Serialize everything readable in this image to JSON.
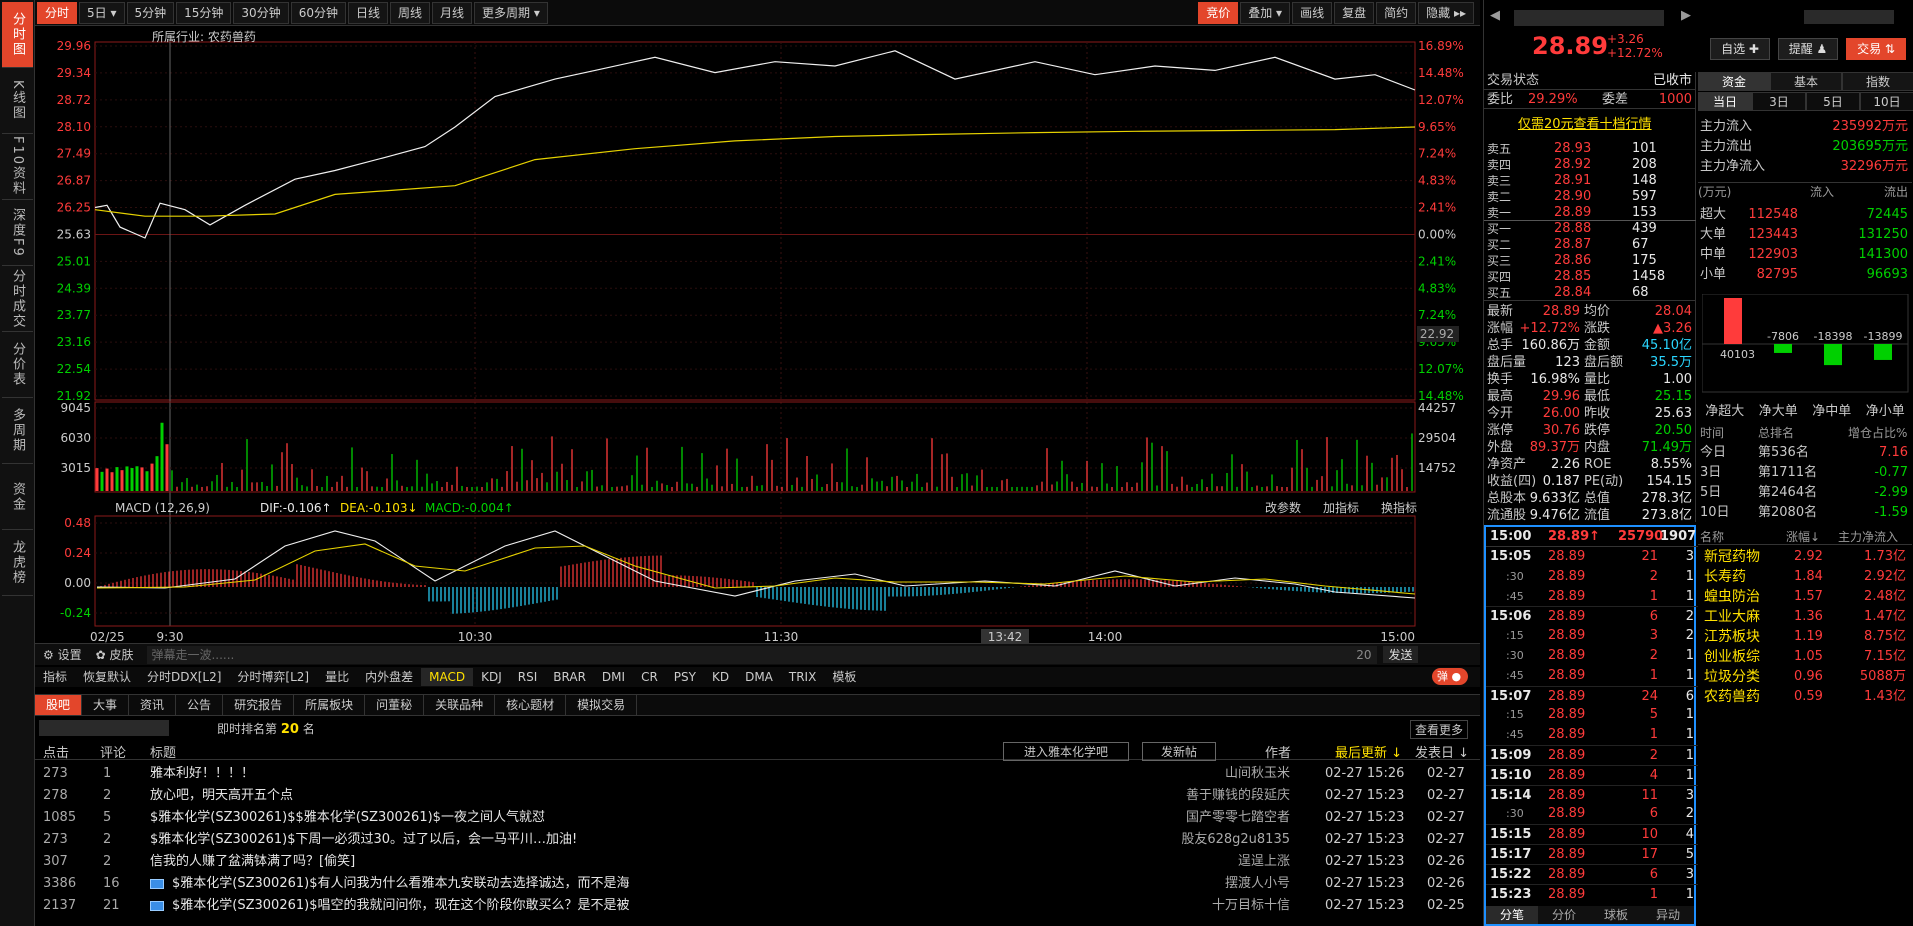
{
  "left_rail": [
    {
      "label": "分时图",
      "active": true
    },
    {
      "label": "K线图"
    },
    {
      "label": "F10资料"
    },
    {
      "label": "深度F9"
    },
    {
      "label": "分时成交"
    },
    {
      "label": "分价表"
    },
    {
      "label": "多周期"
    },
    {
      "label": "资金"
    },
    {
      "label": "龙虎榜"
    }
  ],
  "period_tabs": [
    "分时",
    "5日 ▾",
    "5分钟",
    "15分钟",
    "30分钟",
    "60分钟",
    "日线",
    "周线",
    "月线",
    "更多周期 ▾"
  ],
  "tool_tabs": [
    "竞价",
    "叠加 ▾",
    "画线",
    "复盘",
    "简约",
    "隐藏 ▸▸"
  ],
  "chart_info": {
    "industry_label": "所属行业:",
    "industry": "农药兽药"
  },
  "price_axis_left": [
    "29.96",
    "29.34",
    "28.72",
    "28.10",
    "27.49",
    "26.87",
    "26.25",
    "25.63",
    "25.01",
    "24.39",
    "23.77",
    "23.16",
    "22.54",
    "21.92"
  ],
  "pct_axis_right": [
    "16.89%",
    "14.48%",
    "12.07%",
    "9.65%",
    "7.24%",
    "4.83%",
    "2.41%",
    "0.00%",
    "2.41%",
    "4.83%",
    "7.24%",
    "9.65%",
    "12.07%",
    "14.48%"
  ],
  "cursor_price": "22.92",
  "volume_axis_left": [
    "9045",
    "6030",
    "3015"
  ],
  "volume_axis_right": [
    "44257",
    "29504",
    "14752"
  ],
  "macd_header": {
    "name": "MACD (12,26,9)",
    "dif": "DIF:-0.106↑",
    "dea": "DEA:-0.103↓",
    "macd": "MACD:-0.004↑",
    "right_tools": [
      "改参数",
      "加指标",
      "换指标"
    ]
  },
  "macd_axis": [
    "0.48",
    "0.24",
    "0.00",
    "-0.24"
  ],
  "time_axis": [
    "02/25",
    "9:30",
    "10:30",
    "11:30",
    "13:42",
    "14:00",
    "15:00"
  ],
  "bottom_controls": {
    "settings": "设置",
    "skin": "皮肤",
    "danmu_placeholder": "弹幕走一波......",
    "danmu_count": "20",
    "send": "发送",
    "danmu_toggle": "弹"
  },
  "indicator_tabs": [
    "指标",
    "恢复默认",
    "分时DDX[L2]",
    "分时博弈[L2]",
    "量比",
    "内外盘差",
    "MACD",
    "KDJ",
    "RSI",
    "BRAR",
    "DMI",
    "CR",
    "PSY",
    "KD",
    "DMA",
    "TRIX",
    "模板"
  ],
  "bottom_tabs": [
    "股吧",
    "大事",
    "资讯",
    "公告",
    "研究报告",
    "所属板块",
    "问董秘",
    "关联品种",
    "核心题材",
    "模拟交易"
  ],
  "forum": {
    "rank_label": "即时排名第",
    "rank": "20",
    "rank_unit": "名",
    "more": "查看更多",
    "enter_btn": "进入雅本化学吧",
    "post_btn": "发新帖",
    "cols": [
      "点击",
      "评论",
      "标题",
      "作者",
      "最后更新 ↓",
      "发表日 ↓"
    ],
    "posts": [
      {
        "clicks": "273",
        "comments": "1",
        "title": "雅本利好！！！！",
        "author": "山间秋玉米",
        "updated": "02-27 15:26",
        "date": "02-27",
        "icon": false
      },
      {
        "clicks": "278",
        "comments": "2",
        "title": "放心吧，明天高开五个点",
        "author": "善于赚钱的段延庆",
        "updated": "02-27 15:23",
        "date": "02-27",
        "icon": false
      },
      {
        "clicks": "1085",
        "comments": "5",
        "title": "$雅本化学(SZ300261)$$雅本化学(SZ300261)$一夜之间人气就怼",
        "author": "国产零零七踏空者",
        "updated": "02-27 15:23",
        "date": "02-27",
        "icon": false
      },
      {
        "clicks": "273",
        "comments": "2",
        "title": "$雅本化学(SZ300261)$下周一必须过30。过了以后，会一马平川…加油!",
        "author": "股友628g2u8135",
        "updated": "02-27 15:23",
        "date": "02-27",
        "icon": false
      },
      {
        "clicks": "307",
        "comments": "2",
        "title": "信我的人赚了盆满钵满了吗？[偷笑]",
        "author": "逞逞上涨",
        "updated": "02-27 15:23",
        "date": "02-26",
        "icon": false
      },
      {
        "clicks": "3386",
        "comments": "16",
        "title": "$雅本化学(SZ300261)$有人问我为什么看雅本九安联动去选择诚达，而不是海",
        "author": "摆渡人小号",
        "updated": "02-27 15:23",
        "date": "02-26",
        "icon": true
      },
      {
        "clicks": "2137",
        "comments": "21",
        "title": "$雅本化学(SZ300261)$唱空的我就问问你，现在这个阶段你敢买么？是不是被",
        "author": "十万目标十信",
        "updated": "02-27 15:23",
        "date": "02-25",
        "icon": true
      }
    ]
  },
  "quote": {
    "price": "28.89",
    "change": "+3.26",
    "change_pct": "+12.72%",
    "btn_watch": "自选 ✚",
    "btn_alert": "提醒 ♟",
    "btn_trade": "交易 ⇅"
  },
  "status": {
    "label": "交易状态",
    "value": "已收市",
    "weibi_label": "委比",
    "weibi": "29.29%",
    "weicha_label": "委差",
    "weicha": "1000"
  },
  "ten_level": "仅需20元查看十档行情",
  "asks": [
    {
      "label": "卖五",
      "price": "28.93",
      "vol": "101"
    },
    {
      "label": "卖四",
      "price": "28.92",
      "vol": "208"
    },
    {
      "label": "卖三",
      "price": "28.91",
      "vol": "148"
    },
    {
      "label": "卖二",
      "price": "28.90",
      "vol": "597"
    },
    {
      "label": "卖一",
      "price": "28.89",
      "vol": "153"
    }
  ],
  "bids": [
    {
      "label": "买一",
      "price": "28.88",
      "vol": "439"
    },
    {
      "label": "买二",
      "price": "28.87",
      "vol": "67"
    },
    {
      "label": "买三",
      "price": "28.86",
      "vol": "175"
    },
    {
      "label": "买四",
      "price": "28.85",
      "vol": "1458"
    },
    {
      "label": "买五",
      "price": "28.84",
      "vol": "68"
    }
  ],
  "stats": [
    [
      "最新",
      "28.89",
      "red",
      "均价",
      "28.04",
      "red"
    ],
    [
      "涨幅",
      "+12.72%",
      "red",
      "涨跌",
      "▲3.26",
      "red"
    ],
    [
      "总手",
      "160.86万",
      "white",
      "金额",
      "45.10亿",
      "cyan"
    ],
    [
      "盘后量",
      "123",
      "white",
      "盘后额",
      "35.5万",
      "cyan"
    ],
    [
      "换手",
      "16.98%",
      "white",
      "量比",
      "1.00",
      "white"
    ],
    [
      "最高",
      "29.96",
      "red",
      "最低",
      "25.15",
      "green"
    ],
    [
      "今开",
      "26.00",
      "red",
      "昨收",
      "25.63",
      "white"
    ],
    [
      "涨停",
      "30.76",
      "red",
      "跌停",
      "20.50",
      "green"
    ],
    [
      "外盘",
      "89.37万",
      "red",
      "内盘",
      "71.49万",
      "green"
    ],
    [
      "净资产",
      "2.26",
      "white",
      "ROE",
      "8.55%",
      "white"
    ],
    [
      "收益(四)",
      "0.187",
      "white",
      "PE(动)",
      "154.15",
      "white"
    ],
    [
      "总股本",
      "9.633亿",
      "white",
      "总值",
      "278.3亿",
      "white"
    ],
    [
      "流通股",
      "9.476亿",
      "white",
      "流值",
      "273.8亿",
      "white"
    ]
  ],
  "trades": {
    "last": {
      "time": "15:00",
      "price": "28.89↑",
      "vol": "25790",
      "num": "1907"
    },
    "rows": [
      [
        "15:05",
        "28.89",
        "21",
        "3"
      ],
      [
        ":30",
        "28.89",
        "2",
        "1"
      ],
      [
        ":45",
        "28.89",
        "1",
        "1"
      ],
      [
        "15:06",
        "28.89",
        "6",
        "2"
      ],
      [
        ":15",
        "28.89",
        "3",
        "2"
      ],
      [
        ":30",
        "28.89",
        "2",
        "1"
      ],
      [
        ":45",
        "28.89",
        "1",
        "1"
      ],
      [
        "15:07",
        "28.89",
        "24",
        "6"
      ],
      [
        ":15",
        "28.89",
        "5",
        "1"
      ],
      [
        ":45",
        "28.89",
        "1",
        "1"
      ],
      [
        "15:09",
        "28.89",
        "2",
        "1"
      ],
      [
        "15:10",
        "28.89",
        "4",
        "1"
      ],
      [
        "15:14",
        "28.89",
        "11",
        "3"
      ],
      [
        ":30",
        "28.89",
        "6",
        "2"
      ],
      [
        "15:15",
        "28.89",
        "10",
        "4"
      ],
      [
        "15:17",
        "28.89",
        "17",
        "5"
      ],
      [
        "15:22",
        "28.89",
        "6",
        "3"
      ],
      [
        "15:23",
        "28.89",
        "1",
        "1"
      ]
    ],
    "tabs": [
      "分笔",
      "分价",
      "球板",
      "异动"
    ]
  },
  "fund": {
    "tabs": [
      "资金",
      "基本",
      "指数"
    ],
    "subtabs": [
      "当日",
      "3日",
      "5日",
      "10日"
    ],
    "main_in_label": "主力流入",
    "main_in": "235992万元",
    "main_out_label": "主力流出",
    "main_out": "203695万元",
    "main_net_label": "主力净流入",
    "main_net": "32296万元",
    "unit": "(万元)",
    "flow_in": "流入",
    "flow_out": "流出",
    "orders": [
      [
        "超大",
        "112548",
        "72445"
      ],
      [
        "大单",
        "123443",
        "131250"
      ],
      [
        "中单",
        "122903",
        "141300"
      ],
      [
        "小单",
        "82795",
        "96693"
      ]
    ],
    "net_bars": [
      {
        "label": "净超大",
        "value": 40103
      },
      {
        "label": "净大单",
        "value": -7806
      },
      {
        "label": "净中单",
        "value": -18398
      },
      {
        "label": "净小单",
        "value": -13899
      }
    ],
    "rank_cols": [
      "时间",
      "总排名",
      "增仓占比%"
    ],
    "ranks": [
      [
        "今日",
        "第536名",
        "7.16",
        "red"
      ],
      [
        "3日",
        "第1711名",
        "-0.77",
        "green"
      ],
      [
        "5日",
        "第2464名",
        "-2.99",
        "green"
      ],
      [
        "10日",
        "第2080名",
        "-1.59",
        "green"
      ]
    ],
    "sector_cols": [
      "名称",
      "涨幅↓",
      "主力净流入"
    ],
    "sectors": [
      [
        "新冠药物",
        "2.92",
        "1.73亿"
      ],
      [
        "长寿药",
        "1.84",
        "2.92亿"
      ],
      [
        "蝗虫防治",
        "1.57",
        "2.48亿"
      ],
      [
        "工业大麻",
        "1.36",
        "1.47亿"
      ],
      [
        "江苏板块",
        "1.19",
        "8.75亿"
      ],
      [
        "创业板综",
        "1.05",
        "7.15亿"
      ],
      [
        "垃圾分类",
        "0.96",
        "5088万"
      ],
      [
        "农药兽药",
        "0.59",
        "1.43亿"
      ]
    ]
  },
  "chart_data": {
    "type": "line",
    "title": "",
    "x": [
      "9:30",
      "10:30",
      "11:30",
      "14:00",
      "15:00"
    ],
    "series": [
      {
        "values": [
          26.25,
          25.6,
          26.43,
          27.8,
          28.68,
          29.92,
          29.4,
          29.85,
          29.2,
          28.89
        ]
      },
      {
        "values": [
          26.18,
          26.0,
          26.4,
          26.6,
          27.2,
          27.7,
          27.85,
          28.0,
          28.04
        ]
      }
    ],
    "ylim": [
      21.92,
      29.96
    ],
    "prev_close": 25.63
  }
}
